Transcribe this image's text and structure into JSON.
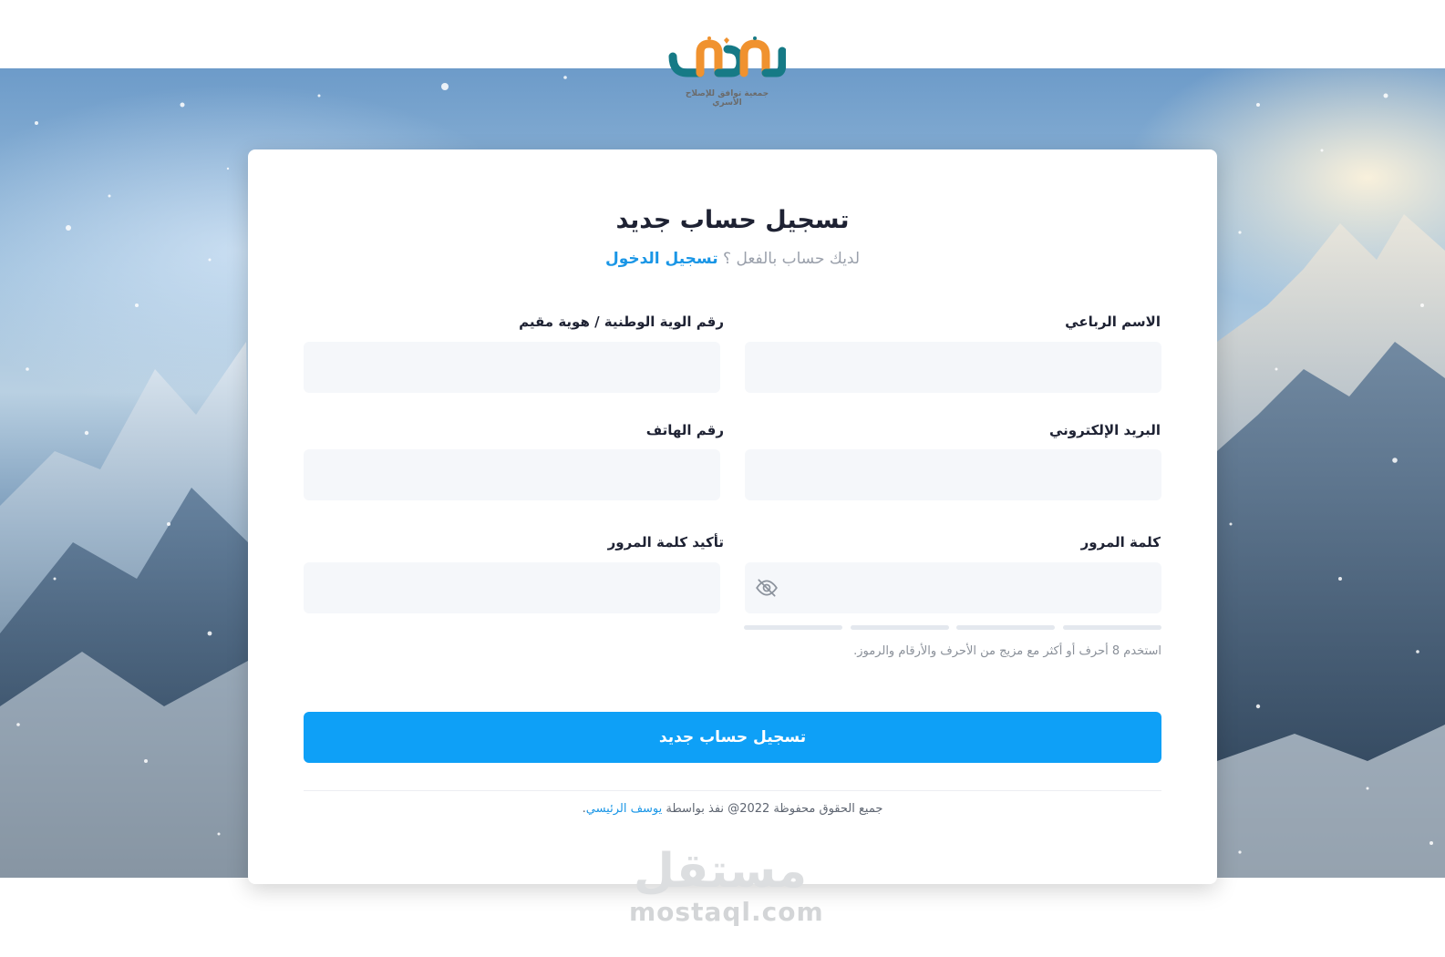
{
  "logo": {
    "tagline": "جمعية توافق للإصلاح الأسري",
    "colors": {
      "teal": "#167a86",
      "orange": "#f0922f"
    }
  },
  "form": {
    "title": "تسجيل حساب جديد",
    "subtitle_prefix": "لديك حساب بالفعل ؟",
    "login_link": "تسجيل الدخول",
    "fields": {
      "full_name": {
        "label": "الاسم الرباعي",
        "value": ""
      },
      "national_id": {
        "label": "رقم الوية الوطنية / هوية مقيم",
        "value": ""
      },
      "email": {
        "label": "البريد الإلكتروني",
        "value": ""
      },
      "phone": {
        "label": "رقم الهاتف",
        "value": ""
      },
      "password": {
        "label": "كلمة المرور",
        "value": "",
        "toggle_icon": "eye-off-icon"
      },
      "confirm_password": {
        "label": "تأكيد كلمة المرور",
        "value": ""
      }
    },
    "password_strength": {
      "segments": 4,
      "filled": 0
    },
    "password_hint": "استخدم 8 أحرف أو أكثر مع مزيج من الأحرف والأرقام والرموز.",
    "submit_label": "تسجيل حساب جديد"
  },
  "footer": {
    "text": "جميع الحقوق محفوظة 2022@ نفذ بواسطة",
    "author": "يوسف الرئيسي",
    "suffix": "."
  },
  "watermark": {
    "arabic": "مستقل",
    "latin": "mostaql.com"
  },
  "theme": {
    "accent": "#0ea0f7",
    "link": "#1a96e6",
    "input_bg": "#f5f7fa"
  }
}
